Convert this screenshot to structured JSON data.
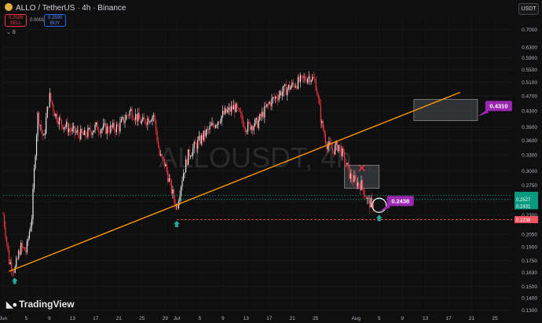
{
  "header": {
    "title": "ALLO / TetherUS · 4h · Binance",
    "sell_price": "0.2589",
    "sell_label": "SELL",
    "spread": "0.0001",
    "buy_price": "0.2590",
    "buy_label": "BUY",
    "layers_count": "6",
    "currency": "USDT"
  },
  "branding": {
    "name": "TradingView"
  },
  "chart_data": {
    "type": "candlestick",
    "symbol": "ALLO / TetherUS",
    "interval": "4h",
    "exchange": "Binance",
    "watermark": "ALLOUSDT, 4h",
    "y_scale": "log",
    "ylim": [
      0.128,
      0.76
    ],
    "y_ticks": [
      "0.7000",
      "0.6300",
      "0.5900",
      "0.5500",
      "0.5100",
      "0.4700",
      "0.4300",
      "0.3900",
      "0.3600",
      "0.3300",
      "0.3000",
      "0.2750",
      "0.2500",
      "0.2300",
      "0.2050",
      "0.1900",
      "0.1750",
      "0.1630",
      "0.1500",
      "0.1400",
      "0.1300"
    ],
    "x_ticks": [
      "Jun",
      "5",
      "9",
      "13",
      "17",
      "21",
      "25",
      "29",
      "Jul",
      "5",
      "9",
      "13",
      "17",
      "21",
      "25",
      "Aug",
      "5",
      "9",
      "13",
      "17",
      "21",
      "25"
    ],
    "x_tick_dates": [
      "2025-06-01",
      "2025-06-05",
      "2025-06-09",
      "2025-06-13",
      "2025-06-17",
      "2025-06-21",
      "2025-06-25",
      "2025-06-29",
      "2025-07-01",
      "2025-07-05",
      "2025-07-09",
      "2025-07-13",
      "2025-07-17",
      "2025-07-21",
      "2025-07-25",
      "2025-08-01",
      "2025-08-05",
      "2025-08-09",
      "2025-08-13",
      "2025-08-17",
      "2025-08-21",
      "2025-08-25"
    ],
    "price_path": [
      [
        "2025-06-01",
        0.23
      ],
      [
        "2025-06-02",
        0.175
      ],
      [
        "2025-06-03",
        0.165
      ],
      [
        "2025-06-04",
        0.19
      ],
      [
        "2025-06-05",
        0.185
      ],
      [
        "2025-06-06",
        0.23
      ],
      [
        "2025-06-07",
        0.42
      ],
      [
        "2025-06-08",
        0.36
      ],
      [
        "2025-06-09",
        0.47
      ],
      [
        "2025-06-10",
        0.42
      ],
      [
        "2025-06-11",
        0.4
      ],
      [
        "2025-06-13",
        0.38
      ],
      [
        "2025-06-15",
        0.37
      ],
      [
        "2025-06-17",
        0.39
      ],
      [
        "2025-06-19",
        0.385
      ],
      [
        "2025-06-21",
        0.39
      ],
      [
        "2025-06-23",
        0.43
      ],
      [
        "2025-06-25",
        0.4
      ],
      [
        "2025-06-27",
        0.42
      ],
      [
        "2025-06-28",
        0.33
      ],
      [
        "2025-06-29",
        0.31
      ],
      [
        "2025-06-30",
        0.27
      ],
      [
        "2025-07-01",
        0.24
      ],
      [
        "2025-07-02",
        0.29
      ],
      [
        "2025-07-03",
        0.33
      ],
      [
        "2025-07-05",
        0.36
      ],
      [
        "2025-07-07",
        0.39
      ],
      [
        "2025-07-09",
        0.42
      ],
      [
        "2025-07-11",
        0.44
      ],
      [
        "2025-07-13",
        0.39
      ],
      [
        "2025-07-15",
        0.4
      ],
      [
        "2025-07-17",
        0.45
      ],
      [
        "2025-07-19",
        0.48
      ],
      [
        "2025-07-21",
        0.5
      ],
      [
        "2025-07-23",
        0.52
      ],
      [
        "2025-07-24",
        0.53
      ],
      [
        "2025-07-25",
        0.51
      ],
      [
        "2025-07-26",
        0.4
      ],
      [
        "2025-07-27",
        0.35
      ],
      [
        "2025-07-28",
        0.34
      ],
      [
        "2025-07-29",
        0.35
      ],
      [
        "2025-07-30",
        0.32
      ],
      [
        "2025-07-31",
        0.29
      ],
      [
        "2025-08-01",
        0.28
      ],
      [
        "2025-08-02",
        0.275
      ],
      [
        "2025-08-03",
        0.25
      ],
      [
        "2025-08-04",
        0.2438
      ]
    ],
    "trendline": {
      "from": [
        "2025-06-02",
        0.164
      ],
      "to": [
        "2025-08-19",
        0.48
      ],
      "color": "#ff9800"
    },
    "zones": [
      {
        "from": "2025-08-11",
        "to": "2025-08-22",
        "low": 0.405,
        "high": 0.46,
        "color": "#787b86"
      },
      {
        "from": "2025-07-30",
        "to": "2025-08-05",
        "low": 0.27,
        "high": 0.31,
        "color": "#787b86"
      }
    ],
    "lines": [
      {
        "price": 0.2589,
        "style": "dotted",
        "color": "#089981"
      },
      {
        "price": 0.2527,
        "style": "dotted",
        "color": "#089981",
        "from": "2025-07-02"
      },
      {
        "price": 0.2238,
        "style": "dashed",
        "color": "#f7525f",
        "from": "2025-07-01"
      }
    ],
    "callouts": [
      {
        "text": "0.4310",
        "date": "2025-08-22",
        "price": 0.431,
        "color": "#9c27b0"
      },
      {
        "text": "0.2438",
        "date": "2025-08-05",
        "price": 0.2438,
        "color": "#9c27b0"
      }
    ],
    "markers": [
      {
        "kind": "up-arrow",
        "date": "2025-06-03",
        "price": 0.155,
        "color": "#26a69a"
      },
      {
        "kind": "up-arrow",
        "date": "2025-07-01",
        "price": 0.218,
        "color": "#26a69a"
      },
      {
        "kind": "up-arrow",
        "date": "2025-08-05",
        "price": 0.226,
        "color": "#26a69a"
      },
      {
        "kind": "cross",
        "date": "2025-08-02",
        "price": 0.305,
        "color": "#f23645"
      },
      {
        "kind": "circle",
        "date": "2025-08-05",
        "price": 0.2438,
        "color": "#ffffff"
      }
    ],
    "price_labels": [
      {
        "text": "0.2589",
        "price": 0.2589,
        "color": "#089981"
      },
      {
        "text": "01:47:53",
        "price": 0.256,
        "color": "#089981",
        "countdown": true
      },
      {
        "text": "0.2527",
        "price": 0.2527,
        "color": "#089981"
      },
      {
        "text": "0.2431",
        "price": 0.2431,
        "color": "#089981"
      },
      {
        "text": "0.2238",
        "price": 0.2238,
        "color": "#f7525f"
      }
    ],
    "colors": {
      "up": "#e8e8e8",
      "down": "#f23645",
      "background": "#0f0f0f"
    }
  }
}
